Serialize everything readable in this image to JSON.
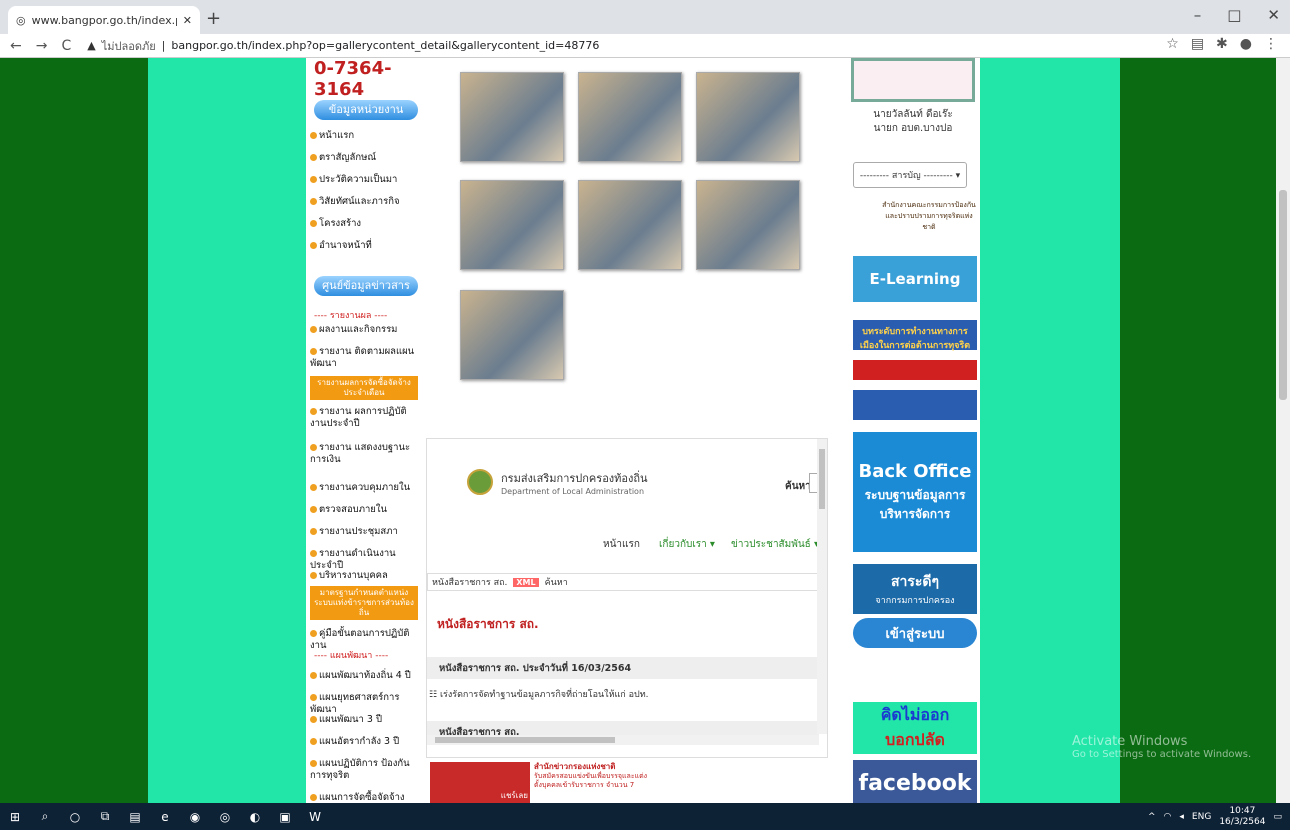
{
  "browser": {
    "tab_title": "www.bangpor.go.th/index.php?o",
    "new_tab": "+",
    "nav_icons": [
      "←",
      "→",
      "C"
    ],
    "security_label": "ไม่ปลอดภัย",
    "url": "bangpor.go.th/index.php?op=gallerycontent_detail&gallerycontent_id=48776",
    "window_buttons": [
      "–",
      "□",
      "✕"
    ]
  },
  "left_menu": {
    "phone": "0-7364-3164",
    "section_info": "ข้อมูลหน่วยงาน",
    "info_items": [
      "หน้าแรก",
      "ตราสัญลักษณ์",
      "ประวัติความเป็นมา",
      "วิสัยทัศน์และภารกิจ",
      "โครงสร้าง",
      "อำนาจหน้าที่"
    ],
    "section_news": "ศูนย์ข้อมูลข่าวสาร",
    "report_header": "---- รายงานผล ----",
    "report_items": [
      "ผลงานและกิจกรรม",
      "รายงาน ติดตามผลแผนพัฒนา",
      "รายงาน ผลการปฏิบัติงานประจำปี",
      "รายงาน แสดงงบฐานะการเงิน",
      "รายงานควบคุมภายใน",
      "ตรวจสอบภายใน",
      "รายงานประชุมสภา",
      "รายงานดำเนินงานประจำปี",
      "บริหารงานบุคคล"
    ],
    "orange_box1": "รายงานผลการจัดซื้อจัดจ้างประจำเดือน",
    "orange_box2": "มาตรฐานกำหนดตำแหน่งระบบแท่งข้าราชการส่วนท้องถิ่น",
    "manual_item": "คู่มือขั้นตอนการปฏิบัติงาน",
    "plan_header": "---- แผนพัฒนา ----",
    "plan_items": [
      "แผนพัฒนาท้องถิ่น 4 ปี",
      "แผนยุทธศาสตร์การพัฒนา",
      "แผนพัฒนา 3 ปี",
      "แผนอัตรากำลัง 3 ปี",
      "แผนปฏิบัติการ ป้องกันการทุจริต",
      "แผนการจัดซื้อจัดจ้าง"
    ]
  },
  "right_col": {
    "person_name": "นายวัลลันท์ ดือเร๊ะ",
    "person_title": "นายก อบต.บางปอ",
    "select_value": "--------- สารบัญ --------- ▾",
    "nacc": "สำนักงานคณะกรรมการป้องกันและปราบปรามการทุจริตแห่งชาติ",
    "elearning": "E-Learning",
    "anti_corruption": "บทระดับการทำงานทางการเมืองในการต่อต้านการทุจริต",
    "backoffice_title": "Back Office",
    "backoffice_sub": "ระบบฐานข้อมูลการบริหารจัดการ",
    "sarad": "สาระดีๆ",
    "sarad_sub": "จากกรมการปกครอง",
    "login": "เข้าสู่ระบบ",
    "think": "คิดไม่ออก",
    "tell": "บอกปลัด",
    "facebook": "facebook"
  },
  "frame": {
    "dept_th": "กรมส่งเสริมการปกครองท้องถิ่น",
    "dept_en": "Department of Local Administration",
    "search_label": "ค้นหา",
    "nav": [
      "หน้าแรก",
      "เกี่ยวกับเรา ▾",
      "ข่าวประชาสัมพันธ์ ▾"
    ],
    "breadcrumb_1": "หนังสือราชการ สถ.",
    "breadcrumb_xml": "XML",
    "breadcrumb_2": "ค้นหา",
    "title": "หนังสือราชการ สถ.",
    "daily_header": "หนังสือราชการ สถ. ประจำวันที่ 16/03/2564",
    "item": "เร่งรัดการจัดทำฐานข้อมูลภารกิจที่ถ่ายโอนให้แก่ อปท.",
    "header2": "หนังสือราชการ สถ."
  },
  "bottom_ad": {
    "left": "แชร์เลย",
    "right1": "สำนักข่าวกรองแห่งชาติ",
    "right2": "รับสมัครสอบแข่งขันเพื่อบรรจุและแต่งตั้งบุคคลเข้ารับราชการ จำนวน 7"
  },
  "watermark": {
    "line1": "Activate Windows",
    "line2": "Go to Settings to activate Windows."
  },
  "taskbar": {
    "lang": "ENG",
    "time": "10:47",
    "date": "16/3/2564"
  }
}
